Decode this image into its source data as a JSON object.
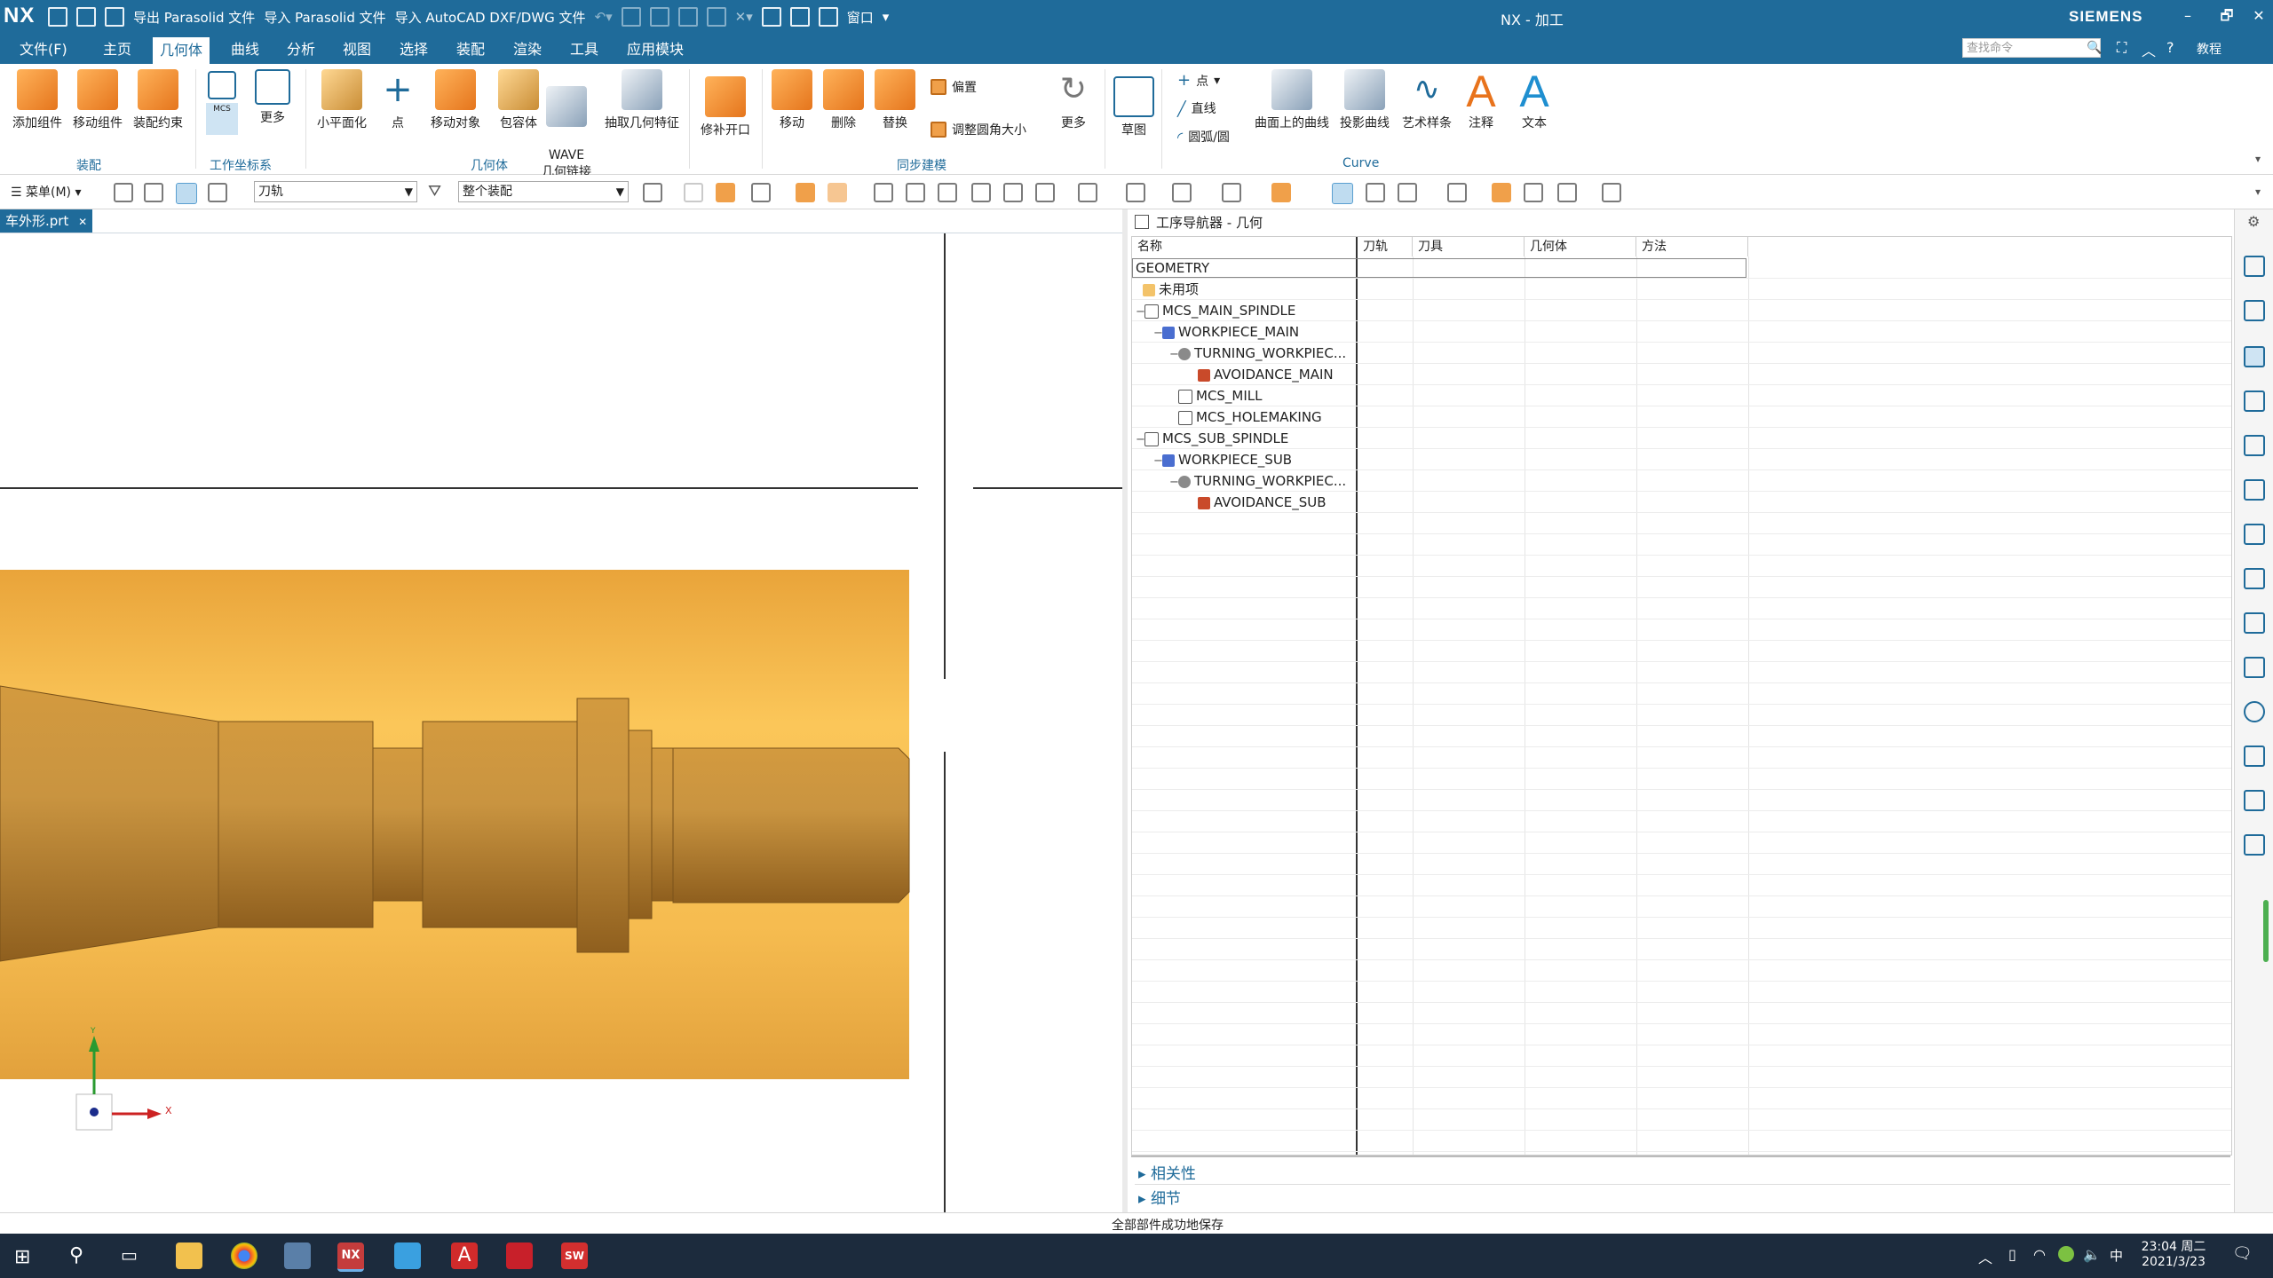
{
  "app": {
    "logo": "NX",
    "window_title": "NX - 加工",
    "brand": "SIEMENS",
    "quick_access": {
      "export_parasolid": "导出 Parasolid 文件",
      "import_parasolid": "导入 Parasolid 文件",
      "import_autocad": "导入 AutoCAD DXF/DWG 文件",
      "window_menu": "窗口"
    },
    "window_controls": {
      "minimize": "–",
      "restore": "🗗",
      "close": "✕"
    }
  },
  "menubar": {
    "items": [
      "文件(F)",
      "主页",
      "几何体",
      "曲线",
      "分析",
      "视图",
      "选择",
      "装配",
      "渲染",
      "工具",
      "应用模块"
    ],
    "active": "几何体",
    "search_placeholder": "查找命令",
    "tutorial": "教程"
  },
  "ribbon": {
    "assembly": {
      "add_component": "添加组件",
      "move_component": "移动组件",
      "assembly_constraint": "装配约束",
      "group_label": "装配"
    },
    "wcs": {
      "more": "更多",
      "group_label": "工作坐标系",
      "mcs_badge": "MCS"
    },
    "geometry": {
      "flatten": "小平面化",
      "point": "点",
      "move_object": "移动对象",
      "wrap": "包容体",
      "wave": "WAVE\n几何链接",
      "extract": "抽取几何特征",
      "group_label": "几何体"
    },
    "repair": {
      "patch_opening": "修补开口"
    },
    "sync": {
      "move": "移动",
      "delete": "删除",
      "replace": "替换",
      "offset": "偏置",
      "resize_blend": "调整圆角大小",
      "more": "更多",
      "group_label": "同步建模"
    },
    "sketch": {
      "label": "草图"
    },
    "curve": {
      "point": "点",
      "line": "直线",
      "arc": "圆弧/圆",
      "curve_on_surface": "曲面上的曲线",
      "project_curve": "投影曲线",
      "art_spline": "艺术样条",
      "annotation": "注释",
      "text": "文本",
      "group_label": "Curve"
    }
  },
  "toolbar2": {
    "menu_label": "菜单(M)",
    "filter_value": "刀轨",
    "scope_value": "整个装配"
  },
  "document": {
    "tab_label": "车外形.prt",
    "close": "✕"
  },
  "viewport": {
    "axis_x": "X",
    "axis_y": "Y"
  },
  "navigator": {
    "title": "工序导航器 - 几何",
    "columns": [
      "名称",
      "刀轨",
      "刀具",
      "几何体",
      "方法"
    ],
    "rows": [
      {
        "label": "GEOMETRY",
        "indent": 0,
        "icon": "none"
      },
      {
        "label": "未用项",
        "indent": 1,
        "icon": "folder-icon"
      },
      {
        "label": "MCS_MAIN_SPINDLE",
        "indent": 1,
        "icon": "mcs-icon"
      },
      {
        "label": "WORKPIECE_MAIN",
        "indent": 2,
        "icon": "workpiece-icon"
      },
      {
        "label": "TURNING_WORKPIEC...",
        "indent": 3,
        "icon": "turning-icon"
      },
      {
        "label": "AVOIDANCE_MAIN",
        "indent": 4,
        "icon": "avoidance-icon"
      },
      {
        "label": "MCS_MILL",
        "indent": 2,
        "icon": "mcs-icon"
      },
      {
        "label": "MCS_HOLEMAKING",
        "indent": 2,
        "icon": "mcs-icon"
      },
      {
        "label": "MCS_SUB_SPINDLE",
        "indent": 1,
        "icon": "mcs-icon"
      },
      {
        "label": "WORKPIECE_SUB",
        "indent": 2,
        "icon": "workpiece-icon"
      },
      {
        "label": "TURNING_WORKPIEC...",
        "indent": 3,
        "icon": "turning-icon"
      },
      {
        "label": "AVOIDANCE_SUB",
        "indent": 4,
        "icon": "avoidance-icon"
      }
    ],
    "sections": [
      "相关性",
      "细节"
    ]
  },
  "status": {
    "message": "全部部件成功地保存"
  },
  "taskbar": {
    "time": "23:04 周二",
    "date": "2021/3/23",
    "ime": "中"
  },
  "colors": {
    "brand_blue": "#1f6b9a",
    "part_gold": "#e9a43a"
  }
}
